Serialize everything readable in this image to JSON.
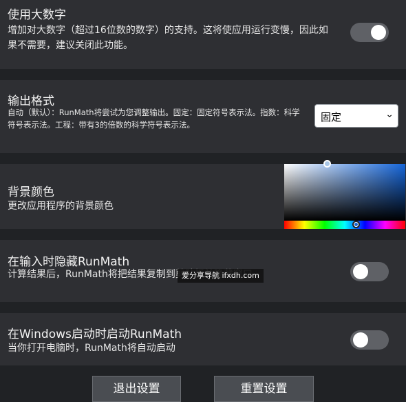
{
  "big_numbers": {
    "title": "使用大数字",
    "description": "增加对大数字（超过16位数的数字）的支持。这将使应用运行变慢，因此如果不需要，建议关闭此功能。",
    "enabled": true
  },
  "output_format": {
    "title": "输出格式",
    "description": "自动（默认）：RunMath将尝试为您调整输出。固定：固定符号表示法。指数：科学符号表示法。工程：带有3的倍数的科学符号表示法。",
    "selected": "固定"
  },
  "background_color": {
    "title": "背景颜色",
    "description": "更改应用程序的背景颜色",
    "colors": {
      "hue": "#1565d8",
      "selected": "#a9c6e6"
    }
  },
  "hide_on_input": {
    "title": "在输入时隐藏RunMath",
    "description": "计算结果后，RunMath将把结果复制到剪贴板并隐藏窗口",
    "enabled": false
  },
  "start_on_boot": {
    "title": "在Windows启动时启动RunMath",
    "description": "当你打开电脑时，RunMath将自动启动",
    "enabled": false
  },
  "watermark": "爱分享导航 ifxdh.com",
  "buttons": {
    "exit": "退出设置",
    "reset": "重置设置"
  },
  "colors": {
    "background": "#202225",
    "card": "#2e2f33",
    "toggle_track": "#5f6166"
  }
}
